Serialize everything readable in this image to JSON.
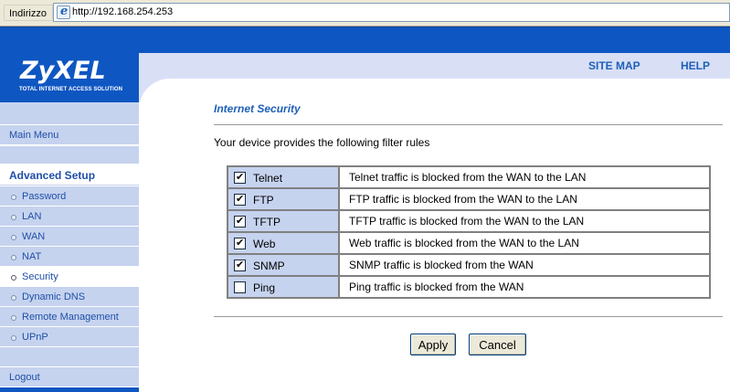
{
  "browser": {
    "address_label": "Indirizzo",
    "url": "http://192.168.254.253"
  },
  "header": {
    "logo": "ZyXEL",
    "tagline": "TOTAL INTERNET ACCESS SOLUTION",
    "site_map": "SITE MAP",
    "help": "HELP"
  },
  "sidebar": {
    "main_menu": "Main Menu",
    "section": "Advanced Setup",
    "items": [
      {
        "label": "Password"
      },
      {
        "label": "LAN"
      },
      {
        "label": "WAN"
      },
      {
        "label": "NAT"
      },
      {
        "label": "Security"
      },
      {
        "label": "Dynamic DNS"
      },
      {
        "label": "Remote Management"
      },
      {
        "label": "UPnP"
      }
    ],
    "selected": "Security",
    "logout": "Logout"
  },
  "main": {
    "title": "Internet Security",
    "intro": "Your device provides the following filter rules",
    "rules": [
      {
        "name": "Telnet",
        "checked": true,
        "description": "Telnet traffic is blocked from the WAN to the LAN"
      },
      {
        "name": "FTP",
        "checked": true,
        "description": "FTP traffic is blocked from the WAN to the LAN"
      },
      {
        "name": "TFTP",
        "checked": true,
        "description": "TFTP traffic is blocked from the WAN to the LAN"
      },
      {
        "name": "Web",
        "checked": true,
        "description": "Web traffic is blocked from the WAN to the LAN"
      },
      {
        "name": "SNMP",
        "checked": true,
        "description": "SNMP traffic is blocked from the WAN"
      },
      {
        "name": "Ping",
        "checked": false,
        "description": "Ping traffic is blocked from the WAN"
      }
    ],
    "apply_label": "Apply",
    "cancel_label": "Cancel"
  },
  "colors": {
    "brand_blue": "#0e56c2",
    "sidebar_bg": "#c6d3ef",
    "link_blue": "#1f5fb8"
  }
}
